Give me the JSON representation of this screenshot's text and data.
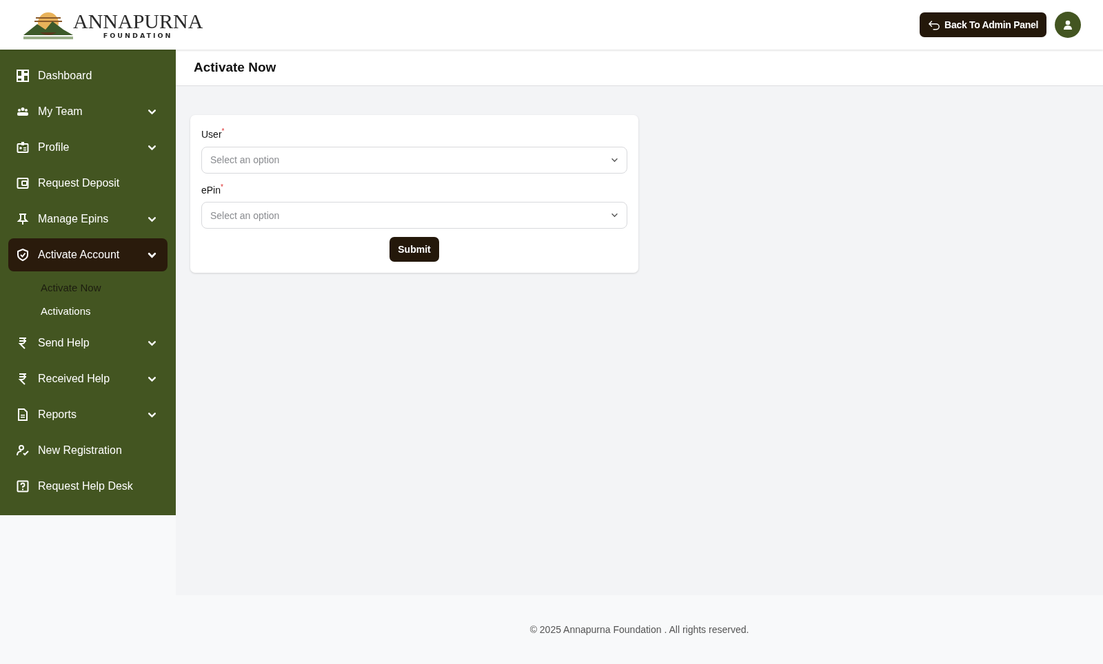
{
  "header": {
    "logo": {
      "name": "ANNAPURNA",
      "tagline": "FOUNDATION"
    },
    "back_button": "Back To Admin Panel"
  },
  "sidebar": {
    "items": [
      {
        "label": "Dashboard",
        "kind": "link",
        "selected": false
      },
      {
        "label": "My Team",
        "kind": "menu",
        "expanded": false,
        "selected": false
      },
      {
        "label": "Profile",
        "kind": "menu",
        "expanded": false,
        "selected": false
      },
      {
        "label": "Request Deposit",
        "kind": "link",
        "selected": false
      },
      {
        "label": "Manage Epins",
        "kind": "menu",
        "expanded": false,
        "selected": false
      },
      {
        "label": "Activate Account",
        "kind": "menu",
        "expanded": true,
        "selected": true,
        "children": [
          {
            "label": "Activate Now",
            "selected": true
          },
          {
            "label": "Activations",
            "selected": false
          }
        ]
      },
      {
        "label": "Send Help",
        "kind": "menu",
        "expanded": false,
        "selected": false
      },
      {
        "label": "Received Help",
        "kind": "menu",
        "expanded": false,
        "selected": false
      },
      {
        "label": "Reports",
        "kind": "menu",
        "expanded": false,
        "selected": false
      },
      {
        "label": "New Registration",
        "kind": "link",
        "selected": false
      },
      {
        "label": "Request Help Desk",
        "kind": "link",
        "selected": false
      }
    ]
  },
  "page_title": "Activate Now",
  "form": {
    "fields": [
      {
        "label": "User",
        "required_mark": "*",
        "placeholder": "Select an option"
      },
      {
        "label": "ePin",
        "required_mark": "*",
        "placeholder": "Select an option"
      }
    ],
    "submit": "Submit"
  },
  "footer": "© 2025 Annapurna Foundation . All rights reserved."
}
